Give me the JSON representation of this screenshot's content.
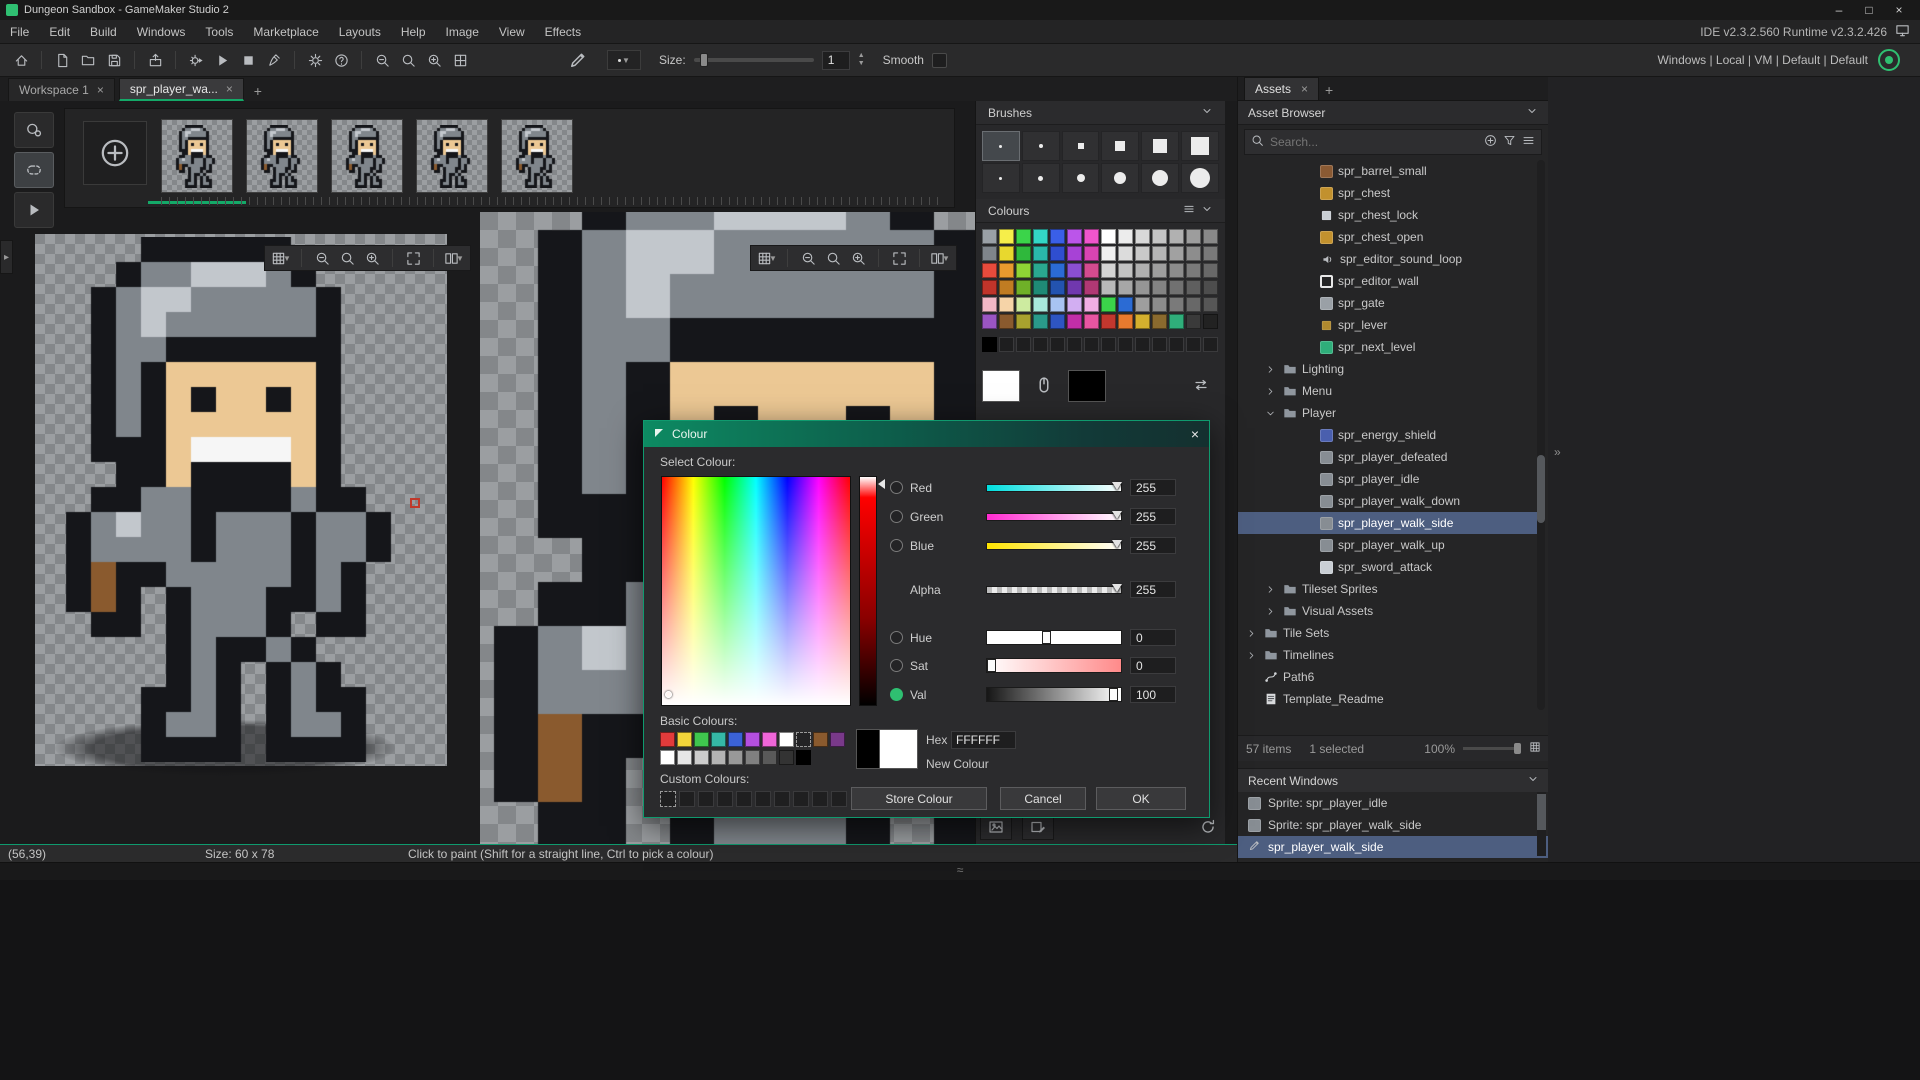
{
  "window": {
    "title": "Dungeon Sandbox - GameMaker Studio 2"
  },
  "menubar": {
    "items": [
      "File",
      "Edit",
      "Build",
      "Windows",
      "Tools",
      "Marketplace",
      "Layouts",
      "Help",
      "Image",
      "View",
      "Effects"
    ],
    "version": "IDE v2.3.2.560 Runtime v2.3.2.426"
  },
  "toolbar": {
    "icons": [
      "home",
      "sep",
      "new-file",
      "open-folder",
      "save",
      "sep",
      "export",
      "sep",
      "run-gear",
      "play",
      "stop",
      "broom",
      "sep",
      "gear",
      "help",
      "sep",
      "zoom-out",
      "zoom-reset",
      "zoom-in",
      "room-grid"
    ],
    "size_label": "Size:",
    "size_value": "1",
    "smooth_label": "Smooth",
    "build_targets": "Windows | Local | VM | Default | Default"
  },
  "tabs": {
    "workspace": "Workspace 1",
    "sprite": "spr_player_wa..."
  },
  "frames": {
    "count": 5,
    "selected": 0
  },
  "canvas_toolbar_icons": [
    "grid-caret",
    "sep",
    "zoom-out",
    "zoom-reset",
    "zoom-in",
    "sep",
    "fit",
    "sep",
    "split-caret"
  ],
  "brushes": {
    "title": "Brushes",
    "sizes": [
      {
        "shape": "dot",
        "size": 3,
        "selected": true
      },
      {
        "shape": "dot",
        "size": 4
      },
      {
        "shape": "square",
        "size": 6
      },
      {
        "shape": "square",
        "size": 10
      },
      {
        "shape": "square",
        "size": 14
      },
      {
        "shape": "square",
        "size": 18
      },
      {
        "shape": "dot",
        "size": 3
      },
      {
        "shape": "dot",
        "size": 5
      },
      {
        "shape": "dot",
        "size": 8
      },
      {
        "shape": "circle",
        "size": 12
      },
      {
        "shape": "circle",
        "size": 16
      },
      {
        "shape": "circle",
        "size": 20
      }
    ]
  },
  "colours": {
    "title": "Colours",
    "palette": [
      [
        "#9aa0a6",
        "#f6ee4a",
        "#3bd44a",
        "#33d6c6",
        "#3a5fe8",
        "#bb55ea",
        "#f055cc",
        "#ffffff",
        "#ececec",
        "#d9d9d9",
        "#c5c5c5",
        "#b1b1b1",
        "#9d9d9d",
        "#898989"
      ],
      [
        "#7f858b",
        "#e8d82e",
        "#2fb83c",
        "#2ab8ab",
        "#2f4ed0",
        "#a742d6",
        "#d944b2",
        "#efefef",
        "#dcdcdc",
        "#c9c9c9",
        "#b5b5b5",
        "#a1a1a1",
        "#8d8d8d",
        "#797979"
      ],
      [
        "#e84b3c",
        "#e89a2e",
        "#8fd435",
        "#2aa890",
        "#2b6bd4",
        "#8a4fd0",
        "#d44b8f",
        "#d4d4d4",
        "#c2c2c2",
        "#b0b0b0",
        "#9e9e9e",
        "#8c8c8c",
        "#7a7a7a",
        "#686868"
      ],
      [
        "#c0342a",
        "#c07c22",
        "#6fb028",
        "#1f8a76",
        "#2353b0",
        "#7038ae",
        "#b03874",
        "#b9b9b9",
        "#a7a7a7",
        "#959595",
        "#838383",
        "#717171",
        "#5f5f5f",
        "#4d4d4d"
      ],
      [
        "#f2b8c6",
        "#f6d4a8",
        "#cdeba0",
        "#a8e8dc",
        "#a8c4f2",
        "#d2aef2",
        "#f2aee4",
        "#3bd44a",
        "#2b6bd4",
        "#9e9e9e",
        "#8c8c8c",
        "#7a7a7a",
        "#686868",
        "#565656"
      ],
      [
        "#9a55c2",
        "#8a5a2e",
        "#a8a22e",
        "#2a9a8a",
        "#2e55c2",
        "#c22ea8",
        "#e855a2",
        "#c2372e",
        "#e87a2e",
        "#d4b02e",
        "#8a6a2e",
        "#2fae7a",
        "#3a3a3a",
        "#222222"
      ]
    ],
    "slots": [
      "#000000",
      "empty",
      "empty",
      "empty",
      "empty",
      "empty",
      "empty",
      "empty",
      "empty",
      "empty",
      "empty",
      "empty",
      "empty",
      "empty"
    ],
    "left_colour": "#ffffff",
    "right_colour": "#000000"
  },
  "colour_dialog": {
    "title": "Colour",
    "select_label": "Select Colour:",
    "channels": [
      {
        "label": "Red",
        "value": "255",
        "track": "red",
        "radio": true,
        "selected": false,
        "handle": "triangle",
        "pos": 97
      },
      {
        "label": "Green",
        "value": "255",
        "track": "green",
        "radio": true,
        "selected": false,
        "handle": "triangle",
        "pos": 97
      },
      {
        "label": "Blue",
        "value": "255",
        "track": "blue",
        "radio": true,
        "selected": false,
        "handle": "triangle",
        "pos": 97
      },
      {
        "label": "Alpha",
        "value": "255",
        "track": "alpha",
        "radio": false,
        "selected": false,
        "handle": "triangle",
        "pos": 97
      },
      {
        "label": "Hue",
        "value": "0",
        "track": "plain",
        "radio": true,
        "selected": false,
        "handle": "square",
        "pos": 45
      },
      {
        "label": "Sat",
        "value": "0",
        "track": "sat",
        "radio": true,
        "selected": false,
        "handle": "square",
        "pos": 4
      },
      {
        "label": "Val",
        "value": "100",
        "track": "val",
        "radio": true,
        "selected": true,
        "handle": "square",
        "pos": 95
      }
    ],
    "basic_label": "Basic Colours:",
    "basic_colours": [
      [
        "#e23b3b",
        "#f2d53a",
        "#3fc64e",
        "#35b8a6",
        "#3b62d6",
        "#b44fe0",
        "#ef66d8",
        "#ffffff",
        "transparent",
        "#8a5a2e",
        "#79398a"
      ],
      [
        "#ffffff",
        "#e6e6e6",
        "#cccccc",
        "#b3b3b3",
        "#999999",
        "#808080",
        "#595959",
        "#333333",
        "#000000"
      ]
    ],
    "old_colour": "#000000",
    "new_colour": "#ffffff",
    "hex_label": "Hex",
    "hex_value": "FFFFFF",
    "new_colour_label": "New Colour",
    "custom_label": "Custom Colours:",
    "custom_slots": [
      "dotted",
      "#1f1f20",
      "#1f1f20",
      "#1f1f20",
      "#1f1f20",
      "#1f1f20",
      "#1f1f20",
      "#1f1f20",
      "#1f1f20",
      "#1f1f20"
    ],
    "buttons": {
      "store": "Store Colour",
      "cancel": "Cancel",
      "ok": "OK"
    }
  },
  "assets": {
    "tab": "Assets",
    "header": "Asset Browser",
    "search_placeholder": "Search...",
    "tree": [
      {
        "label": "spr_barrel_small",
        "kind": "sprite",
        "indent": 3,
        "color": "#8a5a33"
      },
      {
        "label": "spr_chest",
        "kind": "sprite",
        "indent": 3,
        "color": "#c2912e"
      },
      {
        "label": "spr_chest_lock",
        "kind": "sprite",
        "indent": 3,
        "color": "#c9ced4",
        "icon": "small"
      },
      {
        "label": "spr_chest_open",
        "kind": "sprite",
        "indent": 3,
        "color": "#c2912e"
      },
      {
        "label": "spr_editor_sound_loop",
        "kind": "sprite",
        "indent": 3,
        "color": "#caccce",
        "icon": "speaker"
      },
      {
        "label": "spr_editor_wall",
        "kind": "sprite",
        "indent": 3,
        "color": "#f0f0f0",
        "icon": "outline"
      },
      {
        "label": "spr_gate",
        "kind": "sprite",
        "indent": 3,
        "color": "#9aa0a6"
      },
      {
        "label": "spr_lever",
        "kind": "sprite",
        "indent": 3,
        "color": "#b0892e",
        "icon": "small"
      },
      {
        "label": "spr_next_level",
        "kind": "sprite",
        "indent": 3,
        "color": "#2fae7a"
      },
      {
        "label": "Lighting",
        "kind": "folder",
        "indent": 1,
        "expanded": false
      },
      {
        "label": "Menu",
        "kind": "folder",
        "indent": 1,
        "expanded": false
      },
      {
        "label": "Player",
        "kind": "folder",
        "indent": 1,
        "expanded": true
      },
      {
        "label": "spr_energy_shield",
        "kind": "sprite",
        "indent": 3,
        "color": "#4a5fae"
      },
      {
        "label": "spr_player_defeated",
        "kind": "sprite",
        "indent": 3,
        "color": "#878d93"
      },
      {
        "label": "spr_player_idle",
        "kind": "sprite",
        "indent": 3,
        "color": "#878d93"
      },
      {
        "label": "spr_player_walk_down",
        "kind": "sprite",
        "indent": 3,
        "color": "#878d93"
      },
      {
        "label": "spr_player_walk_side",
        "kind": "sprite",
        "indent": 3,
        "color": "#878d93",
        "selected": true
      },
      {
        "label": "spr_player_walk_up",
        "kind": "sprite",
        "indent": 3,
        "color": "#878d93"
      },
      {
        "label": "spr_sword_attack",
        "kind": "sprite",
        "indent": 3,
        "color": "#c9ced4"
      },
      {
        "label": "Tileset Sprites",
        "kind": "folder",
        "indent": 1,
        "expanded": false
      },
      {
        "label": "Visual Assets",
        "kind": "folder",
        "indent": 1,
        "expanded": false
      },
      {
        "label": "Tile Sets",
        "kind": "folder",
        "indent": 0,
        "expanded": false
      },
      {
        "label": "Timelines",
        "kind": "folder",
        "indent": 0,
        "expanded": false
      },
      {
        "label": "Path6",
        "kind": "path",
        "indent": 0
      },
      {
        "label": "Template_Readme",
        "kind": "note",
        "indent": 0
      }
    ],
    "footer": {
      "items": "57 items",
      "selected": "1 selected",
      "zoom": "100%"
    },
    "recent": {
      "title": "Recent Windows",
      "items": [
        {
          "label": "Sprite: spr_player_idle",
          "icon": "sprite"
        },
        {
          "label": "Sprite: spr_player_walk_side",
          "icon": "sprite"
        },
        {
          "label": "spr_player_walk_side",
          "icon": "pencil",
          "selected": true
        }
      ]
    }
  },
  "status": {
    "coords": "(56,39)",
    "size": "Size: 60 x 78",
    "hint": "Click to paint (Shift for a straight line, Ctrl to pick a colour)"
  },
  "sprite": {
    "palette": {
      "K": "#15161a",
      "G": "#80868c",
      "L": "#c2c7cc",
      "D": "#4c5156",
      "S": "#ecc894",
      "W": "#f6f6f6",
      "B": "#8a5a2e",
      "E": "#2c2d30"
    },
    "rows": [
      "....KKKKKK......",
      "...KGGLLLGK.....",
      "..KGLLGGGGGK....",
      "..KGLGGGGGGK....",
      "..KGGKKKKKKK....",
      "..KGKSSSSSSK....",
      "..KGKSKSSKSK....",
      "..KGKSSSSSSK....",
      "..KKKSWWWWSK....",
      "...KKSKKKKSK....",
      "..KKGGKKKKGKK...",
      ".KGLGGKGGGKGGK..",
      ".KGGGGKGGGKGGK..",
      ".KBKKGGGGGKGK...",
      ".KBK.KGGGKKGK...",
      "..KK.KGGGK.KK...",
      ".....KGKKGK.....",
      ".....KGK.KGK....",
      "....KKGK.KGKK...",
      "....KGGK.KGGK...",
      "....KKKK.KKKK..."
    ]
  }
}
